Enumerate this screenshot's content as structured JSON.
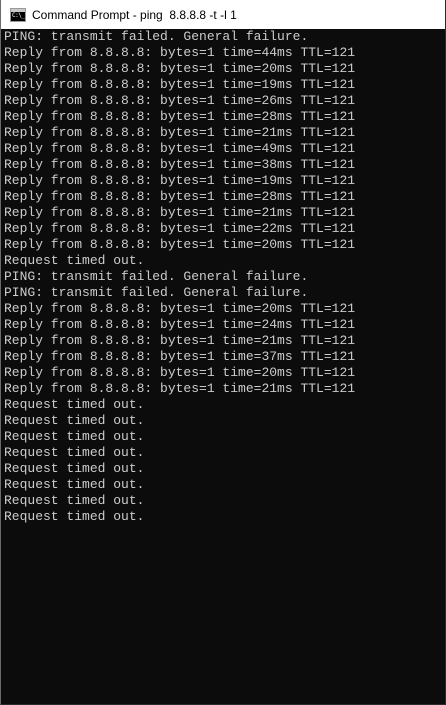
{
  "window": {
    "title": "Command Prompt - ping  8.8.8.8 -t -l 1",
    "icon": "cmd-icon",
    "icon_glyph": "C:\\_"
  },
  "colors": {
    "console_background": "#0c0c0c",
    "console_text": "#cccccc",
    "titlebar_background": "#ffffff"
  },
  "console": {
    "lines": [
      "PING: transmit failed. General failure.",
      "Reply from 8.8.8.8: bytes=1 time=44ms TTL=121",
      "Reply from 8.8.8.8: bytes=1 time=20ms TTL=121",
      "Reply from 8.8.8.8: bytes=1 time=19ms TTL=121",
      "Reply from 8.8.8.8: bytes=1 time=26ms TTL=121",
      "Reply from 8.8.8.8: bytes=1 time=28ms TTL=121",
      "Reply from 8.8.8.8: bytes=1 time=21ms TTL=121",
      "Reply from 8.8.8.8: bytes=1 time=49ms TTL=121",
      "Reply from 8.8.8.8: bytes=1 time=38ms TTL=121",
      "Reply from 8.8.8.8: bytes=1 time=19ms TTL=121",
      "Reply from 8.8.8.8: bytes=1 time=28ms TTL=121",
      "Reply from 8.8.8.8: bytes=1 time=21ms TTL=121",
      "Reply from 8.8.8.8: bytes=1 time=22ms TTL=121",
      "Reply from 8.8.8.8: bytes=1 time=20ms TTL=121",
      "Request timed out.",
      "PING: transmit failed. General failure.",
      "PING: transmit failed. General failure.",
      "Reply from 8.8.8.8: bytes=1 time=20ms TTL=121",
      "Reply from 8.8.8.8: bytes=1 time=24ms TTL=121",
      "Reply from 8.8.8.8: bytes=1 time=21ms TTL=121",
      "Reply from 8.8.8.8: bytes=1 time=37ms TTL=121",
      "Reply from 8.8.8.8: bytes=1 time=20ms TTL=121",
      "Reply from 8.8.8.8: bytes=1 time=21ms TTL=121",
      "Request timed out.",
      "Request timed out.",
      "Request timed out.",
      "Request timed out.",
      "Request timed out.",
      "Request timed out.",
      "Request timed out.",
      "Request timed out."
    ]
  }
}
